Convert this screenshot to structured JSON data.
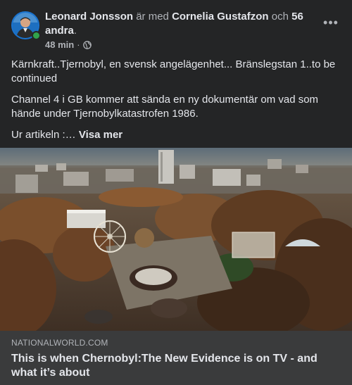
{
  "post": {
    "author": "Leonard Jonsson",
    "with_text": "är med",
    "tagged": "Cornelia Gustafzon",
    "and_text": "och",
    "others": "56 andra",
    "period": ".",
    "timestamp": "48 min",
    "dot": "·",
    "privacy_icon": "globe-icon",
    "more_icon": "•••",
    "paragraph1": "Kärnkraft..Tjernobyl, en svensk angelägenhet... Bränslegstan 1..to be continued",
    "paragraph2": "Channel 4 i GB kommer att sända en ny dokumentär om vad som hände under Tjernobylkatastrofen 1986.",
    "paragraph3_prefix": "Ur artikeln :…",
    "see_more": "Visa mer"
  },
  "link_preview": {
    "domain": "NATIONALWORLD.COM",
    "title": "This is when Chernobyl:The New Evidence is on TV - and what it’s about"
  },
  "colors": {
    "background": "#242526",
    "footer": "#3a3b3c",
    "text_primary": "#e4e6eb",
    "text_secondary": "#b0b3b8",
    "online": "#31a24c"
  }
}
